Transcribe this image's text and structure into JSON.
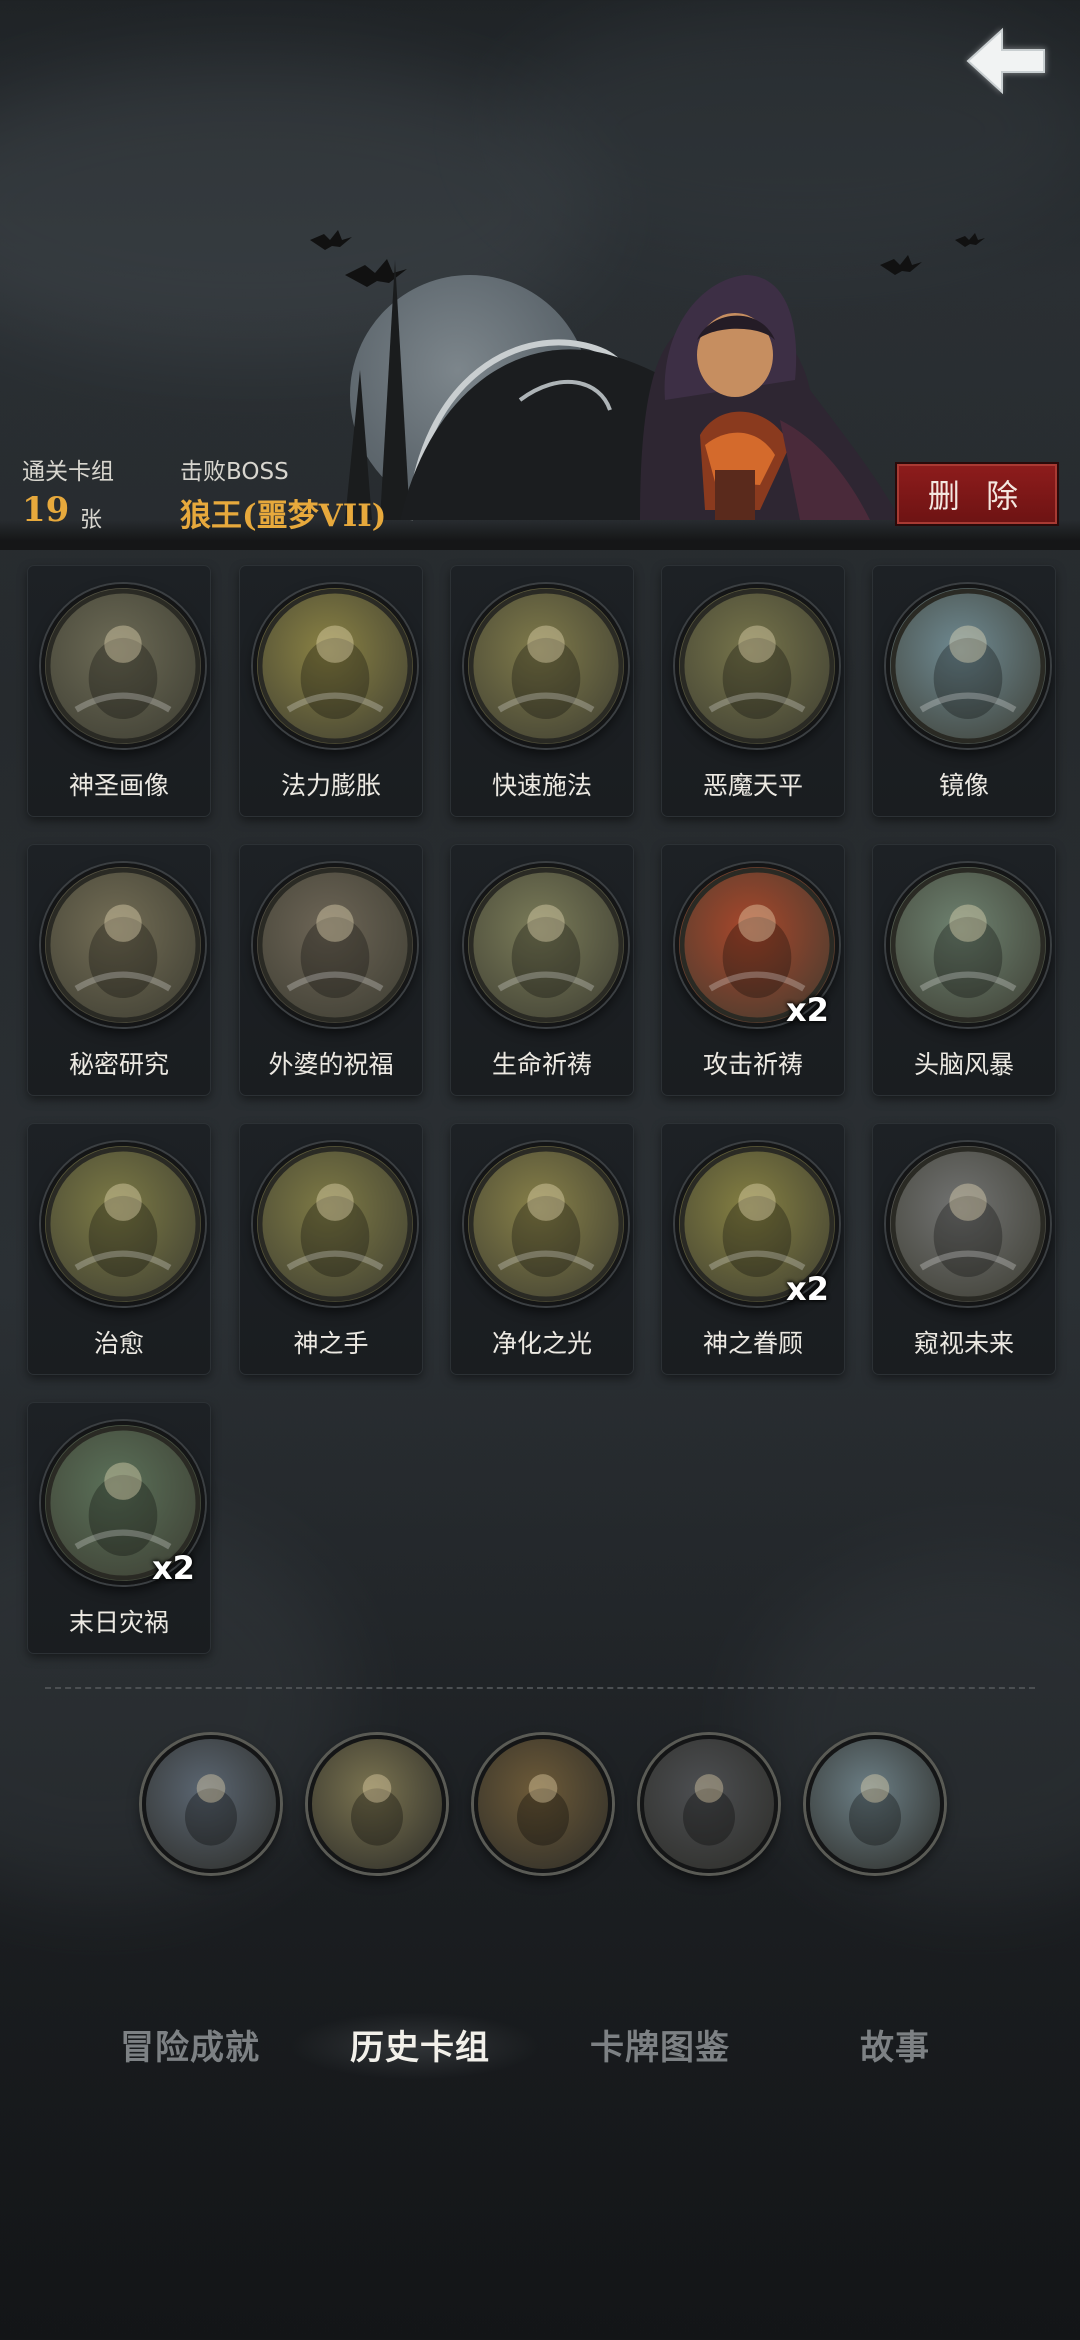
{
  "header": {
    "back_icon": "back-arrow-icon"
  },
  "run_summary": {
    "cleared_deck_label": "通关卡组",
    "card_count": "19",
    "card_unit": "张",
    "defeated_boss_label": "击败BOSS",
    "boss_name": "狼王(噩梦VII)",
    "delete_label": "删 除"
  },
  "cards": [
    {
      "name": "神圣画像",
      "count": "",
      "icon": "holy-portrait-icon",
      "color": "#6c6a55"
    },
    {
      "name": "法力膨胀",
      "count": "",
      "icon": "mana-surge-icon",
      "color": "#8a8244"
    },
    {
      "name": "快速施法",
      "count": "",
      "icon": "quick-cast-icon",
      "color": "#7f7a4a"
    },
    {
      "name": "恶魔天平",
      "count": "",
      "icon": "demon-scale-icon",
      "color": "#76744a"
    },
    {
      "name": "镜像",
      "count": "",
      "icon": "mirror-image-icon",
      "color": "#6f8a92"
    },
    {
      "name": "秘密研究",
      "count": "",
      "icon": "secret-research-icon",
      "color": "#736d55"
    },
    {
      "name": "外婆的祝福",
      "count": "",
      "icon": "grandma-blessing-icon",
      "color": "#6d6556"
    },
    {
      "name": "生命祈祷",
      "count": "",
      "icon": "life-prayer-icon",
      "color": "#7a7b58"
    },
    {
      "name": "攻击祈祷",
      "count": "x2",
      "icon": "attack-prayer-icon",
      "color": "#a8472b"
    },
    {
      "name": "头脑风暴",
      "count": "",
      "icon": "brainstorm-icon",
      "color": "#6e8270"
    },
    {
      "name": "治愈",
      "count": "",
      "icon": "heal-icon",
      "color": "#7c7a45"
    },
    {
      "name": "神之手",
      "count": "",
      "icon": "hand-of-god-icon",
      "color": "#7e7a45"
    },
    {
      "name": "净化之光",
      "count": "",
      "icon": "purifying-light-icon",
      "color": "#878048"
    },
    {
      "name": "神之眷顾",
      "count": "x2",
      "icon": "divine-favor-icon",
      "color": "#858042"
    },
    {
      "name": "窥视未来",
      "count": "",
      "icon": "foresight-icon",
      "color": "#727372"
    },
    {
      "name": "末日灾祸",
      "count": "x2",
      "icon": "doom-calamity-icon",
      "color": "#5b7159"
    }
  ],
  "relics": [
    {
      "icon": "moon-relic-icon"
    },
    {
      "icon": "scroll-relic-icon"
    },
    {
      "icon": "demon-relic-icon"
    },
    {
      "icon": "priest-relic-icon"
    },
    {
      "icon": "hand-cards-relic-icon"
    }
  ],
  "tabs": [
    {
      "label": "冒险成就",
      "active": false
    },
    {
      "label": "历史卡组",
      "active": true
    },
    {
      "label": "卡牌图鉴",
      "active": false
    },
    {
      "label": "故事",
      "active": false
    }
  ],
  "colors": {
    "accent_gold": "#e7a93c",
    "delete_red": "#8e1c1c"
  }
}
